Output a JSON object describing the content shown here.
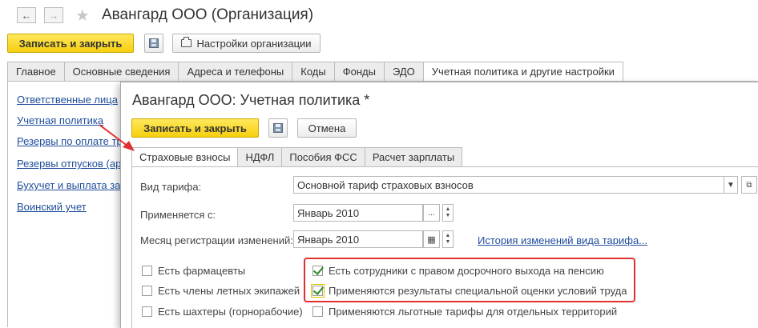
{
  "window": {
    "title": "Авангард ООО (Организация)",
    "back_icon": "arrow-left-icon",
    "forward_icon": "arrow-right-icon",
    "favorite_icon": "star-icon"
  },
  "toolbar": {
    "save_close_label": "Записать и закрыть",
    "settings_label": "Настройки организации"
  },
  "tabs": [
    {
      "label": "Главное"
    },
    {
      "label": "Основные сведения"
    },
    {
      "label": "Адреса и телефоны"
    },
    {
      "label": "Коды"
    },
    {
      "label": "Фонды"
    },
    {
      "label": "ЭДО"
    },
    {
      "label": "Учетная политика и другие настройки"
    }
  ],
  "sidebar": {
    "links": [
      {
        "label": "Ответственные лица"
      },
      {
        "label": "Учетная политика"
      },
      {
        "label": "Резервы по оплате тру"
      },
      {
        "label": "Резервы отпусков (ар"
      },
      {
        "label": "Бухучет и выплата за"
      },
      {
        "label": "Воинский учет"
      }
    ]
  },
  "modal": {
    "title": "Авангард ООО: Учетная политика *",
    "save_close_label": "Записать и закрыть",
    "cancel_label": "Отмена",
    "tabs": [
      {
        "label": "Страховые взносы"
      },
      {
        "label": "НДФЛ"
      },
      {
        "label": "Пособия ФСС"
      },
      {
        "label": "Расчет зарплаты"
      }
    ],
    "tariff_type": {
      "label": "Вид тарифа:",
      "value": "Основной тариф страховых взносов"
    },
    "applies_from": {
      "label": "Применяется с:",
      "value": "Январь 2010",
      "button": "..."
    },
    "reg_month": {
      "label": "Месяц регистрации изменений:",
      "value": "Январь 2010"
    },
    "history_link": "История изменений вида тарифа...",
    "checkboxes_left": [
      {
        "label": "Есть фармацевты",
        "checked": false
      },
      {
        "label": "Есть члены летных экипажей",
        "checked": false
      },
      {
        "label": "Есть шахтеры (горнорабочие)",
        "checked": false
      }
    ],
    "checkboxes_right": [
      {
        "label": "Есть сотрудники с правом досрочного выхода на пенсию",
        "checked": true
      },
      {
        "label": "Применяются результаты специальной оценки условий труда",
        "checked": true
      },
      {
        "label": "Применяются льготные тарифы для отдельных территорий",
        "checked": false
      }
    ]
  },
  "colors": {
    "accent_yellow": "#f6cf0e",
    "link_blue": "#1f4d9b",
    "highlight_red": "#e03030",
    "check_green": "#2a8a2a"
  }
}
